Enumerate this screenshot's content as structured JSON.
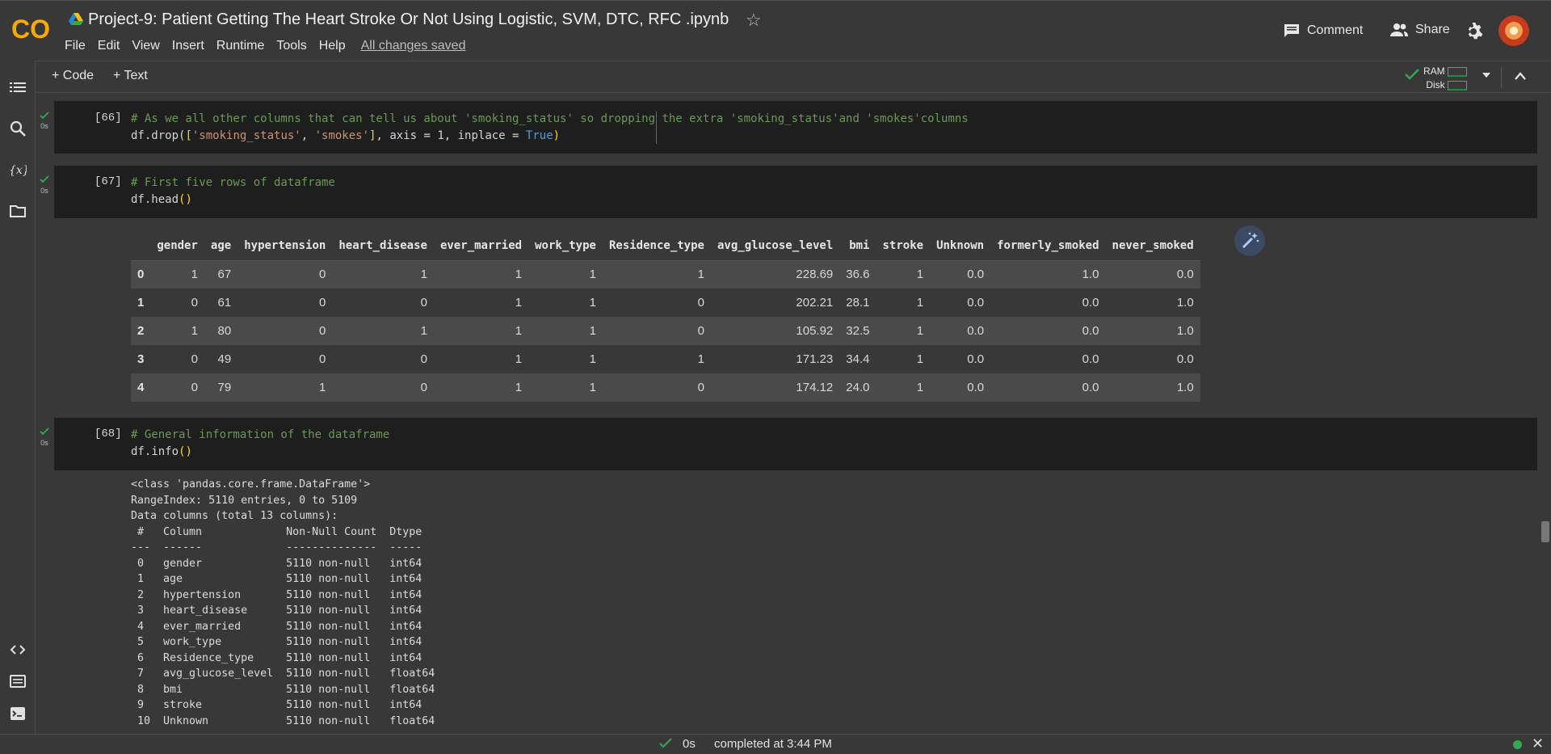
{
  "header": {
    "title": "Project-9: Patient Getting The Heart Stroke Or Not Using Logistic,  SVM, DTC, RFC .ipynb",
    "logo_text": "CO",
    "menu": [
      "File",
      "Edit",
      "View",
      "Insert",
      "Runtime",
      "Tools",
      "Help"
    ],
    "save_status": "All changes saved",
    "comment_label": "Comment",
    "share_label": "Share"
  },
  "toolbar": {
    "add_code": "+ Code",
    "add_text": "+ Text",
    "ram_label": "RAM",
    "disk_label": "Disk"
  },
  "cells": {
    "c66": {
      "exec": "[66]",
      "time": "0s",
      "comment": "# As we all other columns that can tell us about 'smoking_status' so dropping the extra 'smoking_status'and 'smokes'columns",
      "code_prefix": "df.drop(",
      "code_str1": "'smoking_status'",
      "code_str2": "'smokes'",
      "code_rest": ", axis = 1, inplace = ",
      "code_kw": "True"
    },
    "c67": {
      "exec": "[67]",
      "time": "0s",
      "comment": "# First five rows of dataframe",
      "code": "df.head"
    },
    "c68": {
      "exec": "[68]",
      "time": "0s",
      "comment": "# General information of the dataframe",
      "code": "df.info"
    }
  },
  "dataframe": {
    "columns": [
      "",
      "gender",
      "age",
      "hypertension",
      "heart_disease",
      "ever_married",
      "work_type",
      "Residence_type",
      "avg_glucose_level",
      "bmi",
      "stroke",
      "Unknown",
      "formerly_smoked",
      "never_smoked"
    ],
    "rows": [
      [
        "0",
        "1",
        "67",
        "0",
        "1",
        "1",
        "1",
        "1",
        "228.69",
        "36.6",
        "1",
        "0.0",
        "1.0",
        "0.0"
      ],
      [
        "1",
        "0",
        "61",
        "0",
        "0",
        "1",
        "1",
        "0",
        "202.21",
        "28.1",
        "1",
        "0.0",
        "0.0",
        "1.0"
      ],
      [
        "2",
        "1",
        "80",
        "0",
        "1",
        "1",
        "1",
        "0",
        "105.92",
        "32.5",
        "1",
        "0.0",
        "0.0",
        "1.0"
      ],
      [
        "3",
        "0",
        "49",
        "0",
        "0",
        "1",
        "1",
        "1",
        "171.23",
        "34.4",
        "1",
        "0.0",
        "0.0",
        "0.0"
      ],
      [
        "4",
        "0",
        "79",
        "1",
        "0",
        "1",
        "1",
        "0",
        "174.12",
        "24.0",
        "1",
        "0.0",
        "0.0",
        "1.0"
      ]
    ]
  },
  "info_output": [
    "<class 'pandas.core.frame.DataFrame'>",
    "RangeIndex: 5110 entries, 0 to 5109",
    "Data columns (total 13 columns):",
    " #   Column             Non-Null Count  Dtype  ",
    "---  ------             --------------  -----  ",
    " 0   gender             5110 non-null   int64  ",
    " 1   age                5110 non-null   int64  ",
    " 2   hypertension       5110 non-null   int64  ",
    " 3   heart_disease      5110 non-null   int64  ",
    " 4   ever_married       5110 non-null   int64  ",
    " 5   work_type          5110 non-null   int64  ",
    " 6   Residence_type     5110 non-null   int64  ",
    " 7   avg_glucose_level  5110 non-null   float64",
    " 8   bmi                5110 non-null   float64",
    " 9   stroke             5110 non-null   int64  ",
    " 10  Unknown            5110 non-null   float64"
  ],
  "statusbar": {
    "time": "0s",
    "completed": "completed at 3:44 PM"
  },
  "colors": {
    "background": "#383838",
    "cell_bg": "#1e1e1e",
    "accent_green": "#34a853",
    "logo_orange": "#f9ab00"
  }
}
